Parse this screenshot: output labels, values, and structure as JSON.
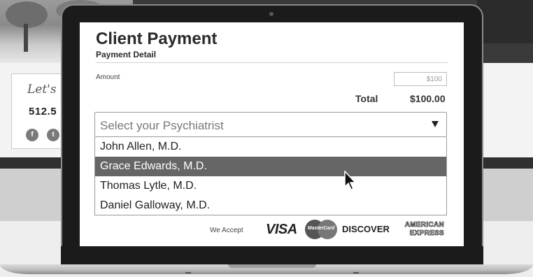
{
  "background": {
    "contact": {
      "greeting": "Let's",
      "phone": "512.5",
      "social": [
        {
          "icon": "facebook-icon",
          "glyph": "f"
        },
        {
          "icon": "twitter-icon",
          "glyph": "t"
        }
      ]
    }
  },
  "payment": {
    "title": "Client Payment",
    "subtitle": "Payment Detail",
    "amount_label": "Amount",
    "amount_value": "$100",
    "total_label": "Total",
    "total_value": "$100.00"
  },
  "select": {
    "placeholder": "Select your Psychiatrist",
    "options": [
      {
        "label": "John Allen, M.D.",
        "highlighted": false
      },
      {
        "label": "Grace Edwards, M.D.",
        "highlighted": true
      },
      {
        "label": "Thomas Lytle, M.D.",
        "highlighted": false
      },
      {
        "label": "Daniel Galloway, M.D.",
        "highlighted": false
      }
    ]
  },
  "cards": {
    "accept_label": "We Accept",
    "visa": "VISA",
    "mastercard": "MasterCard",
    "discover": "DISCOVER",
    "amex_line1": "AMERICAN",
    "amex_line2": "EXPRESS"
  },
  "colors": {
    "highlight": "#666666",
    "laptop_bezel": "#1b1b1b"
  }
}
